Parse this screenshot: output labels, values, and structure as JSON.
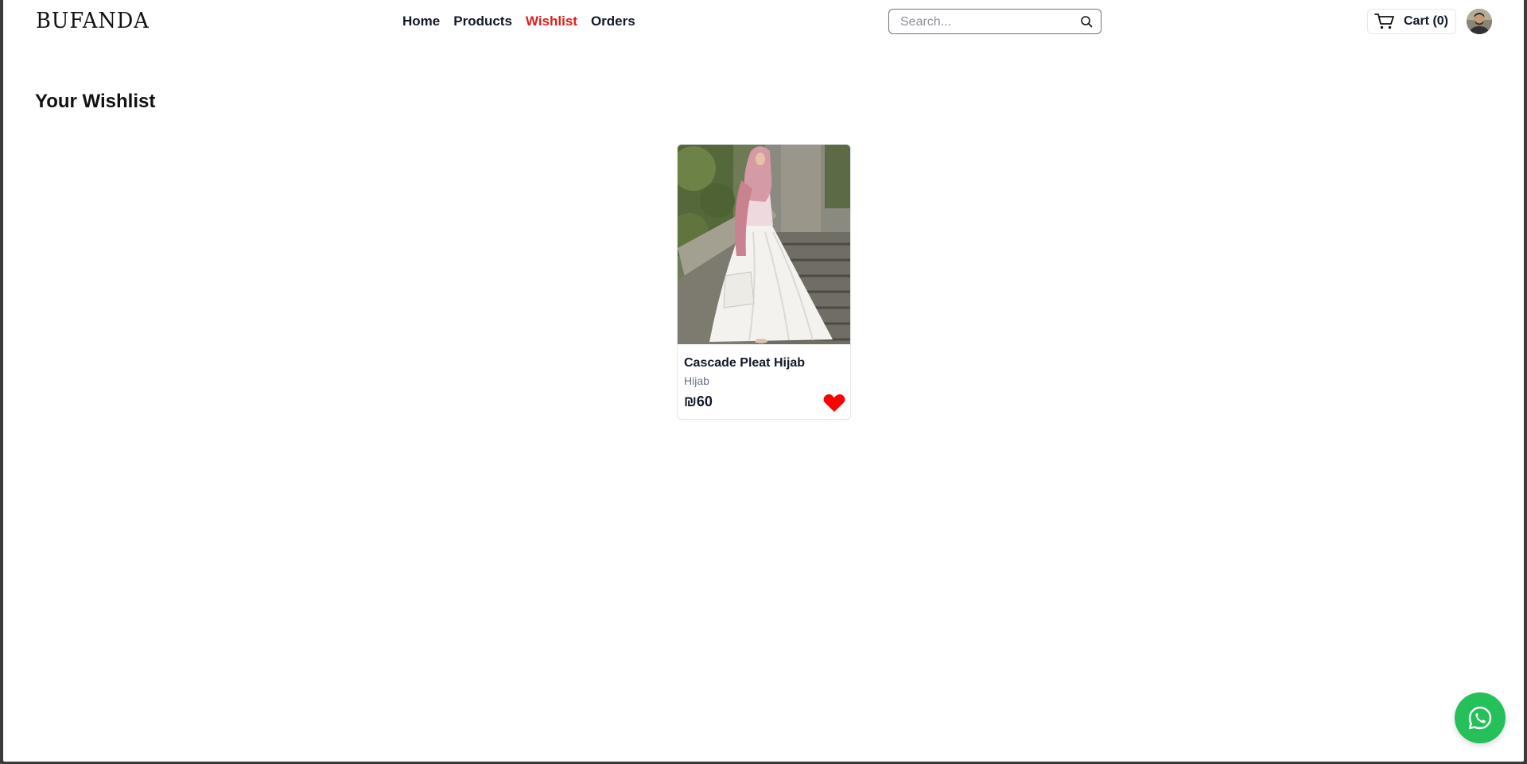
{
  "header": {
    "logo_text": "BUFANDA",
    "nav": [
      {
        "label": "Home",
        "active": false
      },
      {
        "label": "Products",
        "active": false
      },
      {
        "label": "Wishlist",
        "active": true
      },
      {
        "label": "Orders",
        "active": false
      }
    ],
    "search": {
      "placeholder": "Search...",
      "value": "",
      "icon": "search-icon"
    },
    "cart": {
      "label": "Cart (0)",
      "icon": "cart-icon"
    },
    "avatar": {
      "icon": "user-avatar"
    }
  },
  "main": {
    "title": "Your Wishlist",
    "items": [
      {
        "name": "Cascade Pleat Hijab",
        "category": "Hijab",
        "price": "₪60",
        "favorite": true,
        "image": "product-photo"
      }
    ]
  },
  "floating": {
    "whatsapp_icon": "whatsapp-icon"
  },
  "colors": {
    "accent": "#e11d1d",
    "heart": "#ff0000",
    "whatsapp": "#25c05a",
    "text": "#111827",
    "muted": "#6b7280"
  }
}
